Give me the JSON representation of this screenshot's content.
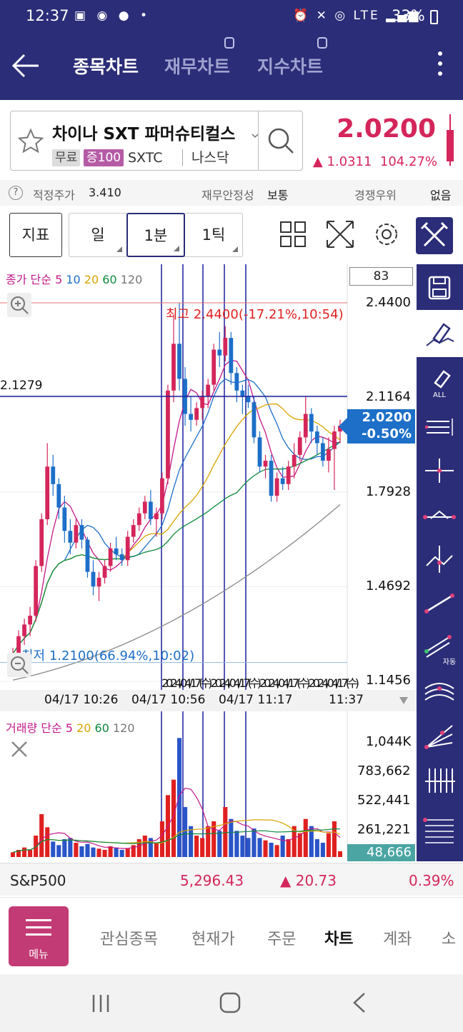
{
  "status_bar": {
    "time": "12:37",
    "battery": "33%",
    "network": "LTE"
  },
  "header": {
    "tabs": [
      {
        "label": "종목차트",
        "active": true
      },
      {
        "label": "재무차트",
        "active": false
      },
      {
        "label": "지수차트",
        "active": false
      }
    ]
  },
  "stock": {
    "name": "차이나 SXT 파머슈티컬스",
    "chip_free": "무료",
    "chip_margin": "증100",
    "code": "SXTC",
    "market": "나스닥",
    "price": "2.0200",
    "change": "▲ 1.0311",
    "change_pct": "104.27%",
    "up_color": "#d4265b"
  },
  "info": {
    "fair_label": "적정주가",
    "fair_value": "3.410",
    "stability_label": "재무안정성",
    "stability_value": "보통",
    "competitive_label": "경쟁우위",
    "competitive_value": "없음"
  },
  "toolbar": {
    "indicator": "지표",
    "period_day": "일",
    "period_min": "1분",
    "period_tick": "1틱"
  },
  "chart": {
    "legend_price": {
      "label": "종가 단순",
      "ma": [
        "5",
        "10",
        "20",
        "60",
        "120"
      ]
    },
    "legend_volume": {
      "label": "거래량 단순",
      "ma": [
        "5",
        "20",
        "60",
        "120"
      ]
    },
    "count_box": "83",
    "high_label": "최고 2.4400(-17.21%,10:54)",
    "low_label": "최저 1.2100(66.94%,10:02)",
    "crosshair_value": "2.1279",
    "price_axis": [
      "2.4400",
      "2.1164",
      "1.7928",
      "1.4692",
      "1.1456"
    ],
    "current_price": "2.0200",
    "current_change": "-0.50%",
    "time_axis": [
      "04/17 10:26",
      "04/17 10:56",
      "04/17 11:17",
      "11:37"
    ],
    "overlap_text": "2024/04/17(수) 2024/04/17(수) 2024/04/17(수) 2024/04/17(수)",
    "volume_axis": [
      "1,044K",
      "783,662",
      "522,441",
      "261,221"
    ],
    "current_volume": "48,666"
  },
  "chart_data": {
    "type": "candlestick",
    "title": "",
    "ylim": [
      1.1456,
      2.44
    ],
    "y_ticks": [
      2.44,
      2.1164,
      1.7928,
      1.4692,
      1.1456
    ],
    "x_ticks": [
      "04/17 10:26",
      "04/17 10:56",
      "04/17 11:17",
      "11:37"
    ],
    "candles": [
      [
        1.22,
        1.26,
        1.2,
        1.24
      ],
      [
        1.24,
        1.32,
        1.22,
        1.3
      ],
      [
        1.3,
        1.36,
        1.27,
        1.34
      ],
      [
        1.34,
        1.4,
        1.3,
        1.37
      ],
      [
        1.37,
        1.56,
        1.35,
        1.54
      ],
      [
        1.54,
        1.72,
        1.52,
        1.7
      ],
      [
        1.7,
        1.96,
        1.68,
        1.88
      ],
      [
        1.88,
        1.92,
        1.78,
        1.82
      ],
      [
        1.82,
        1.84,
        1.7,
        1.74
      ],
      [
        1.74,
        1.78,
        1.62,
        1.66
      ],
      [
        1.66,
        1.7,
        1.58,
        1.62
      ],
      [
        1.62,
        1.7,
        1.6,
        1.68
      ],
      [
        1.68,
        1.7,
        1.6,
        1.63
      ],
      [
        1.63,
        1.64,
        1.5,
        1.52
      ],
      [
        1.52,
        1.56,
        1.44,
        1.47
      ],
      [
        1.47,
        1.52,
        1.42,
        1.5
      ],
      [
        1.5,
        1.56,
        1.48,
        1.54
      ],
      [
        1.54,
        1.62,
        1.52,
        1.6
      ],
      [
        1.6,
        1.64,
        1.56,
        1.58
      ],
      [
        1.58,
        1.6,
        1.54,
        1.56
      ],
      [
        1.56,
        1.66,
        1.54,
        1.64
      ],
      [
        1.64,
        1.7,
        1.62,
        1.68
      ],
      [
        1.68,
        1.74,
        1.66,
        1.72
      ],
      [
        1.72,
        1.78,
        1.7,
        1.76
      ],
      [
        1.76,
        1.8,
        1.68,
        1.7
      ],
      [
        1.7,
        1.74,
        1.64,
        1.72
      ],
      [
        1.72,
        1.86,
        1.7,
        1.84
      ],
      [
        1.84,
        2.16,
        1.82,
        2.14
      ],
      [
        2.14,
        2.4,
        2.1,
        2.3
      ],
      [
        2.3,
        2.44,
        2.14,
        2.18
      ],
      [
        2.18,
        2.22,
        2.02,
        2.06
      ],
      [
        2.06,
        2.12,
        2.0,
        2.04
      ],
      [
        2.04,
        2.1,
        2.02,
        2.08
      ],
      [
        2.08,
        2.14,
        2.04,
        2.12
      ],
      [
        2.12,
        2.18,
        2.08,
        2.16
      ],
      [
        2.16,
        2.3,
        2.14,
        2.28
      ],
      [
        2.28,
        2.34,
        2.22,
        2.26
      ],
      [
        2.26,
        2.36,
        2.24,
        2.32
      ],
      [
        2.32,
        2.34,
        2.16,
        2.2
      ],
      [
        2.2,
        2.22,
        2.1,
        2.14
      ],
      [
        2.14,
        2.16,
        2.06,
        2.12
      ],
      [
        2.12,
        2.16,
        2.08,
        2.1
      ],
      [
        2.1,
        2.12,
        1.96,
        1.98
      ],
      [
        1.98,
        2.0,
        1.86,
        1.88
      ],
      [
        1.88,
        1.92,
        1.84,
        1.9
      ],
      [
        1.9,
        1.92,
        1.76,
        1.78
      ],
      [
        1.78,
        1.86,
        1.76,
        1.84
      ],
      [
        1.84,
        1.88,
        1.8,
        1.82
      ],
      [
        1.82,
        1.9,
        1.8,
        1.88
      ],
      [
        1.88,
        1.96,
        1.84,
        1.92
      ],
      [
        1.92,
        2.0,
        1.9,
        1.98
      ],
      [
        1.98,
        2.12,
        1.96,
        2.06
      ],
      [
        2.06,
        2.08,
        1.96,
        2.0
      ],
      [
        2.0,
        2.02,
        1.92,
        1.96
      ],
      [
        1.96,
        1.98,
        1.88,
        1.9
      ],
      [
        1.9,
        1.98,
        1.86,
        1.94
      ],
      [
        1.94,
        2.02,
        1.8,
        2.0
      ],
      [
        2.0,
        2.04,
        1.96,
        2.02
      ]
    ],
    "volume_axis_ticks": [
      "1,044K",
      "783,662",
      "522,441",
      "261,221"
    ],
    "volume_max": 1044000,
    "volumes": [
      40000,
      60000,
      80000,
      60000,
      180000,
      360000,
      250000,
      130000,
      100000,
      150000,
      160000,
      120000,
      90000,
      110000,
      80000,
      70000,
      60000,
      90000,
      80000,
      60000,
      70000,
      100000,
      150000,
      180000,
      160000,
      120000,
      300000,
      520000,
      650000,
      1000000,
      420000,
      260000,
      180000,
      160000,
      260000,
      300000,
      220000,
      420000,
      320000,
      220000,
      180000,
      160000,
      240000,
      160000,
      140000,
      120000,
      100000,
      180000,
      150000,
      260000,
      200000,
      320000,
      260000,
      150000,
      120000,
      200000,
      300000,
      48666
    ],
    "current_volume": 48666
  },
  "index_row": {
    "name": "S&P500",
    "value": "5,296.43",
    "change": "▲ 20.73",
    "pct": "0.39%"
  },
  "bottom_nav": {
    "menu_label": "메뉴",
    "tabs": [
      {
        "label": "관심종목",
        "active": false
      },
      {
        "label": "현재가",
        "active": false
      },
      {
        "label": "주문",
        "active": false
      },
      {
        "label": "차트",
        "active": true
      },
      {
        "label": "계좌",
        "active": false
      },
      {
        "label": "소",
        "active": false
      }
    ]
  }
}
